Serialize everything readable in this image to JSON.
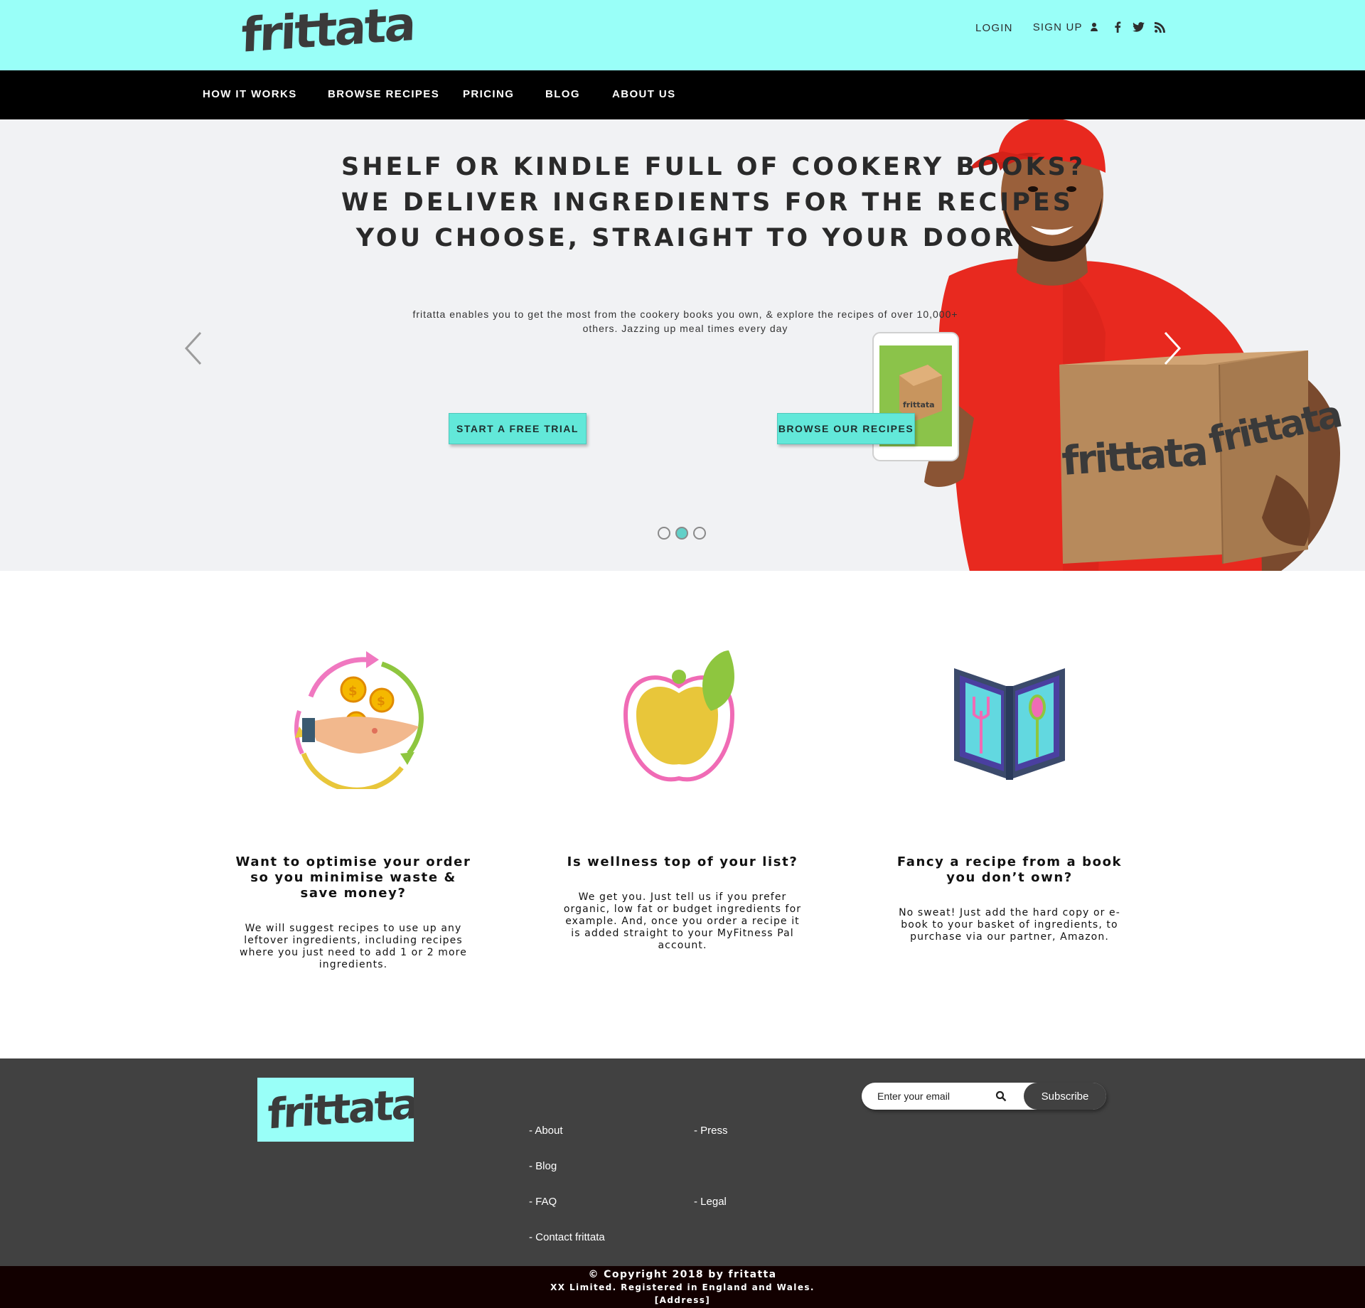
{
  "brand": {
    "name": "frittata",
    "accent": "#99fff8",
    "button": "#62e8d9"
  },
  "header": {
    "login": "LOGIN",
    "signup": "SIGN UP",
    "social_icons": [
      "facebook-icon",
      "twitter-icon",
      "rss-icon"
    ]
  },
  "nav": {
    "items": [
      "HOW IT WORKS",
      "BROWSE RECIPES",
      "PRICING",
      "BLOG",
      "ABOUT US"
    ]
  },
  "hero": {
    "title_lines": [
      "SHELF OR KINDLE FULL OF COOKERY BOOKS?",
      "WE DELIVER INGREDIENTS FOR THE RECIPES",
      "YOU CHOOSE, STRAIGHT TO YOUR DOOR"
    ],
    "text_line1": "fritatta enables you to get the most from the cookery books you own, & explore the recipes of over 10,000+",
    "text_line2": "others. Jazzing up meal times every day",
    "cta_trial": "START A FREE TRIAL",
    "cta_browse": "BROWSE OUR RECIPES",
    "box_label": "frittata",
    "slides": 3,
    "active_slide": 2
  },
  "features": [
    {
      "title": "Want to optimise your order so you minimise waste & save money?",
      "text": "We will suggest recipes to use up any leftover ingredients, including recipes where you just need to add 1 or 2 more ingredients.",
      "icon": "money-hand-icon"
    },
    {
      "title": "Is wellness top of your list?",
      "text": "We get you. Just tell us if you prefer organic, low fat or budget ingredients for example. And, once you order a recipe it is added straight to your MyFitness Pal account.",
      "icon": "apple-icon"
    },
    {
      "title": "Fancy a recipe from a book you don’t own?",
      "text": "No sweat! Just add the hard copy or e-book to your basket of ingredients, to purchase via our partner, Amazon.",
      "icon": "recipe-book-icon"
    }
  ],
  "footer": {
    "links": {
      "about": "- About",
      "press": "- Press",
      "blog": "- Blog",
      "faq": "- FAQ",
      "legal": "- Legal",
      "contact": "- Contact frittata"
    },
    "email_placeholder": "Enter your email",
    "subscribe": "Subscribe"
  },
  "copyright": {
    "line1": "© Copyright 2018 by fritatta",
    "line2": "XX Limited. Registered in England and Wales.",
    "line3": "[Address]"
  }
}
